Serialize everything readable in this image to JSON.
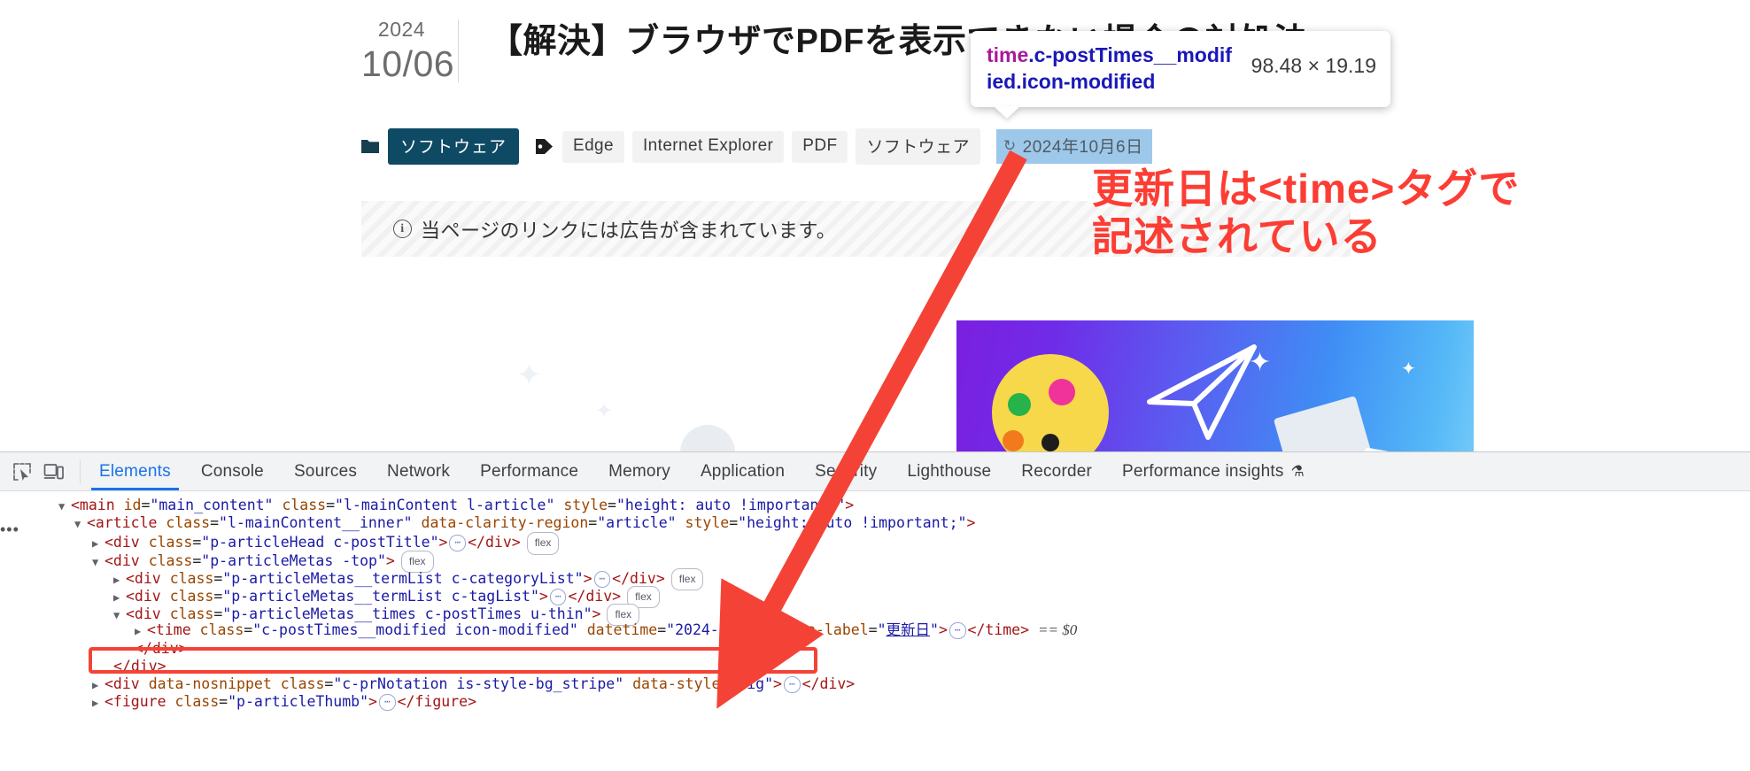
{
  "page": {
    "date": {
      "year": "2024",
      "monthday": "10/06"
    },
    "title": "【解決】ブラウザでPDFを表示できない場合の対処法",
    "metas": {
      "category_icon": "folder-icon",
      "category": "ソフトウェア",
      "tag_icon": "tag-icon",
      "tags": [
        "Edge",
        "Internet Explorer",
        "PDF",
        "ソフトウェア"
      ],
      "modified_icon": "sync-icon",
      "modified_date": "2024年10月6日"
    },
    "pr_notation": {
      "icon": "info-icon",
      "text": "当ページのリンクには広告が含まれています。"
    }
  },
  "annotation": {
    "line1": "更新日は<time>タグで",
    "line2": "記述されている",
    "color": "#fc3d34"
  },
  "inspector_tooltip": {
    "selector_tag": "time",
    "selector_classes": ".c-postTimes__modified.icon-modified",
    "size": "98.48 × 19.19"
  },
  "devtools": {
    "tools": [
      {
        "name": "inspect-element-icon",
        "label": ""
      },
      {
        "name": "device-toolbar-icon",
        "label": ""
      }
    ],
    "tabs": [
      {
        "label": "Elements",
        "active": true
      },
      {
        "label": "Console",
        "active": false
      },
      {
        "label": "Sources",
        "active": false
      },
      {
        "label": "Network",
        "active": false
      },
      {
        "label": "Performance",
        "active": false
      },
      {
        "label": "Memory",
        "active": false
      },
      {
        "label": "Application",
        "active": false
      },
      {
        "label": "Security",
        "active": false
      },
      {
        "label": "Lighthouse",
        "active": false
      },
      {
        "label": "Recorder",
        "active": false
      },
      {
        "label": "Performance insights",
        "active": false,
        "flask": "⚗"
      }
    ],
    "gutter_dots": "•••",
    "dom": {
      "l1": {
        "twist": "open",
        "indent": 0,
        "tag_open": "<main",
        "attrs": [
          [
            "id",
            "main_content"
          ],
          [
            "class",
            "l-mainContent l-article"
          ],
          [
            "style",
            "height: auto !important;"
          ]
        ],
        "close": ">"
      },
      "l2": {
        "twist": "open",
        "indent": 1,
        "tag_open": "<article",
        "attrs": [
          [
            "class",
            "l-mainContent__inner"
          ],
          [
            "data-clarity-region",
            "article"
          ],
          [
            "style",
            "height: auto !important;"
          ]
        ],
        "close": ">"
      },
      "l3": {
        "twist": "closed",
        "indent": 2,
        "tag_open": "<div",
        "attrs": [
          [
            "class",
            "p-articleHead c-postTitle"
          ]
        ],
        "close": ">",
        "ellipsis": true,
        "tag_close": "</div>",
        "badge": "flex"
      },
      "l4": {
        "twist": "open",
        "indent": 2,
        "tag_open": "<div",
        "attrs": [
          [
            "class",
            "p-articleMetas -top"
          ]
        ],
        "close": ">",
        "badge": "flex"
      },
      "l5": {
        "twist": "closed",
        "indent": 3,
        "tag_open": "<div",
        "attrs": [
          [
            "class",
            "p-articleMetas__termList c-categoryList"
          ]
        ],
        "close": ">",
        "ellipsis": true,
        "tag_close": "</div>",
        "badge": "flex"
      },
      "l6": {
        "twist": "closed",
        "indent": 3,
        "tag_open": "<div",
        "attrs": [
          [
            "class",
            "p-articleMetas__termList c-tagList"
          ]
        ],
        "close": ">",
        "ellipsis": true,
        "tag_close": "</div>",
        "badge": "flex"
      },
      "l7": {
        "twist": "open",
        "indent": 3,
        "tag_open": "<div",
        "attrs": [
          [
            "class",
            "p-articleMetas__times c-postTimes u-thin"
          ]
        ],
        "close": ">",
        "badge": "flex"
      },
      "l8": {
        "twist": "closed",
        "indent": 4,
        "tag_open": "<time",
        "attrs": [
          [
            "class",
            "c-postTimes__modified icon-modified"
          ],
          [
            "datetime",
            "2024-10-06"
          ],
          [
            "aria-label",
            "更新日"
          ]
        ],
        "close": ">",
        "ellipsis": true,
        "tag_close": "</time>",
        "selected_marker": "== $0",
        "highlighted": true
      },
      "l9": {
        "indent": 4,
        "text": "</div>"
      },
      "l10": {
        "indent": 3,
        "text": "</div>"
      },
      "l11": {
        "twist": "closed",
        "indent": 2,
        "tag_open": "<div",
        "attrs": [
          [
            "data-nosnippet",
            null
          ],
          [
            "class",
            "c-prNotation is-style-bg_stripe"
          ],
          [
            "data-style",
            "big"
          ]
        ],
        "close": ">",
        "ellipsis": true,
        "tag_close": "</div>"
      },
      "l12": {
        "twist": "closed",
        "indent": 2,
        "tag_open": "<figure",
        "attrs": [
          [
            "class",
            "p-articleThumb"
          ]
        ],
        "close": ">",
        "ellipsis": true,
        "tag_close": "</figure>"
      }
    }
  }
}
